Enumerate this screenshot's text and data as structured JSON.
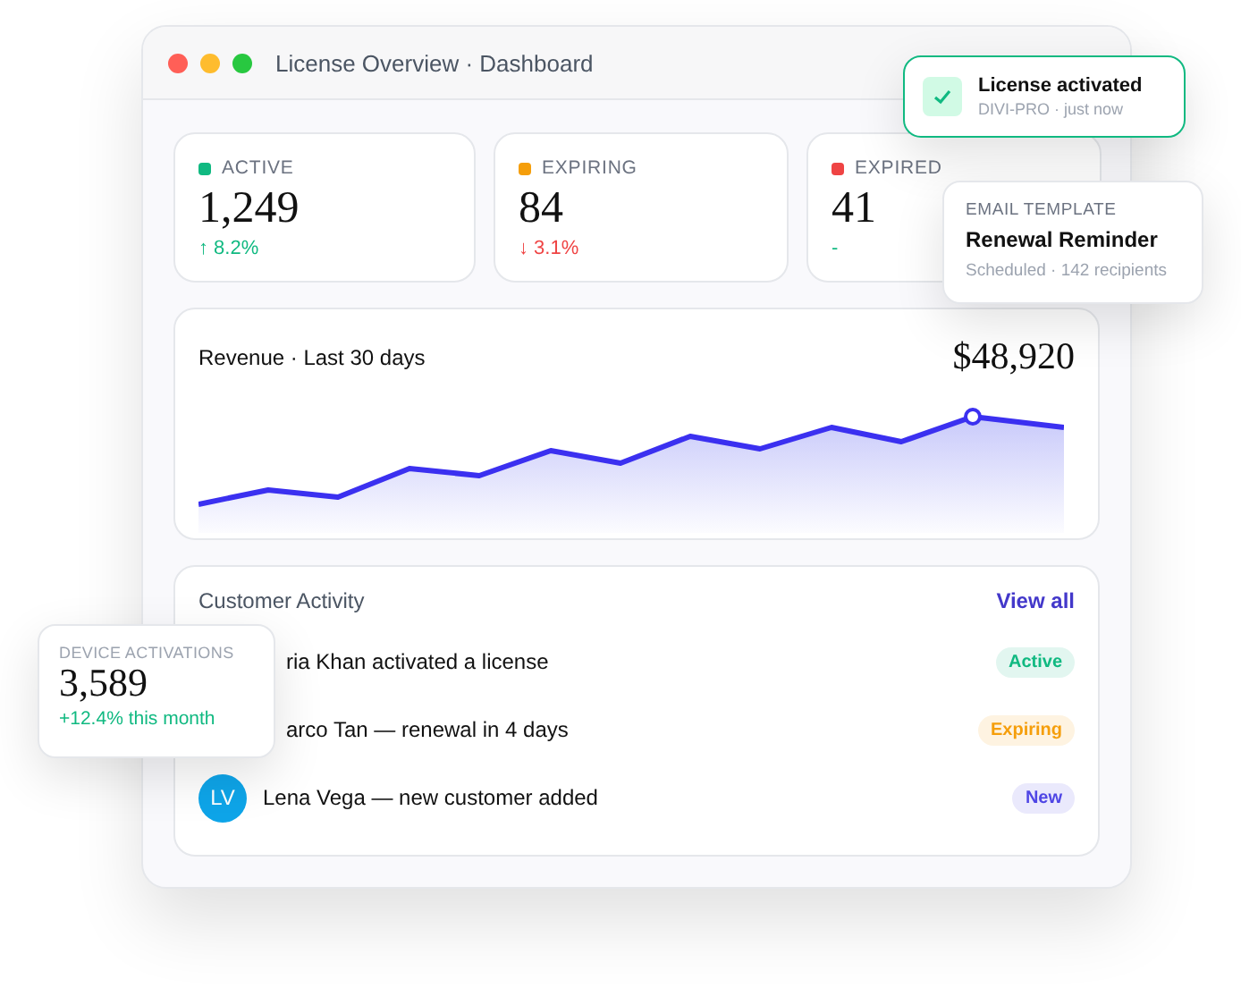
{
  "window": {
    "title": "License Overview · Dashboard"
  },
  "stats": [
    {
      "label": "ACTIVE",
      "color": "#10b981",
      "value": "1,249",
      "change": {
        "text": "↑ 8.2%",
        "color": "#10b981"
      }
    },
    {
      "label": "EXPIRING",
      "color": "#f59e0b",
      "value": "84",
      "change": {
        "text": "↓ 3.1%",
        "color": "#ef4444"
      }
    },
    {
      "label": "EXPIRED",
      "color": "#ef4444",
      "value": "41",
      "change": {
        "text": "-",
        "color": "#10b981"
      }
    }
  ],
  "revenue": {
    "title": "Revenue · Last 30 days",
    "total": "$48,920"
  },
  "activity": {
    "title": "Customer Activity",
    "link": "View all",
    "items": [
      {
        "text": "ria Khan activated a license",
        "badge": "Active",
        "color": "#10b981"
      },
      {
        "text": "arco Tan — renewal in 4 days",
        "badge": "Expiring",
        "color": "#f59e0b"
      },
      {
        "avatar": "LV",
        "text": "Lena Vega — new customer added",
        "badge": "New",
        "color": "#4f46e5"
      }
    ]
  },
  "toast": {
    "title": "License activated",
    "subtitle": "DIVI-PRO · just now"
  },
  "email_card": {
    "label": "EMAIL TEMPLATE",
    "title": "Renewal Reminder",
    "subtitle": "Scheduled · 142 recipients"
  },
  "device_card": {
    "label": "DEVICE ACTIVATIONS",
    "value": "3,589",
    "change": "+12.4% this month"
  }
}
